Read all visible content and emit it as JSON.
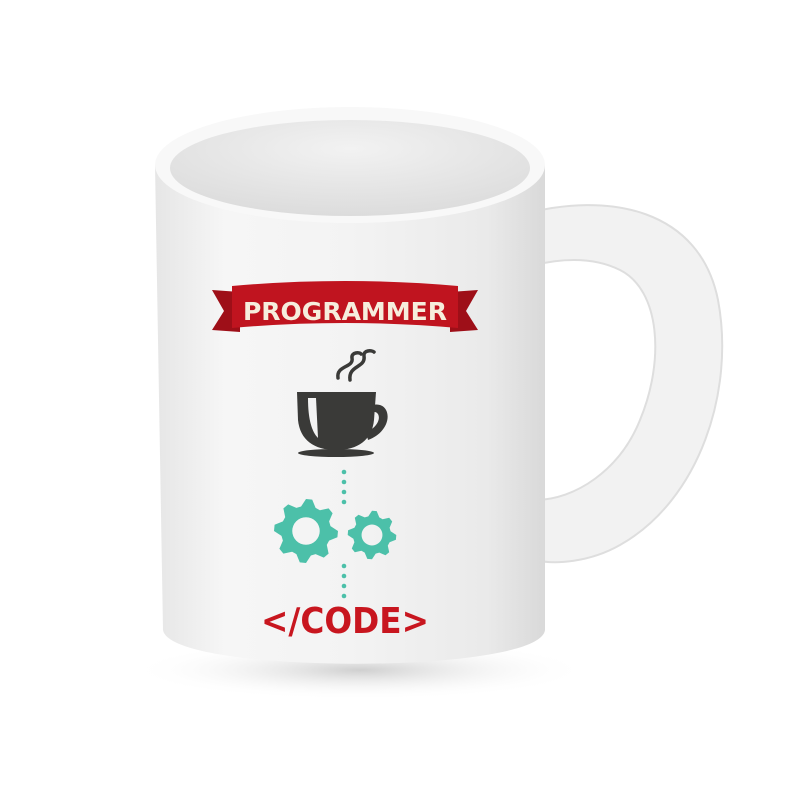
{
  "product": "mug",
  "banner": {
    "text": "PROGRAMMER"
  },
  "footer_text": "</CODE>",
  "icons": [
    "coffee-cup-icon",
    "steam-icon",
    "gears-icon"
  ],
  "colors": {
    "banner_red": "#c0141f",
    "banner_text": "#f6eedd",
    "cup": "#3a3a38",
    "gears": "#4cc0a9",
    "code_text": "#c8161f",
    "mug": "#f7f7f7"
  }
}
